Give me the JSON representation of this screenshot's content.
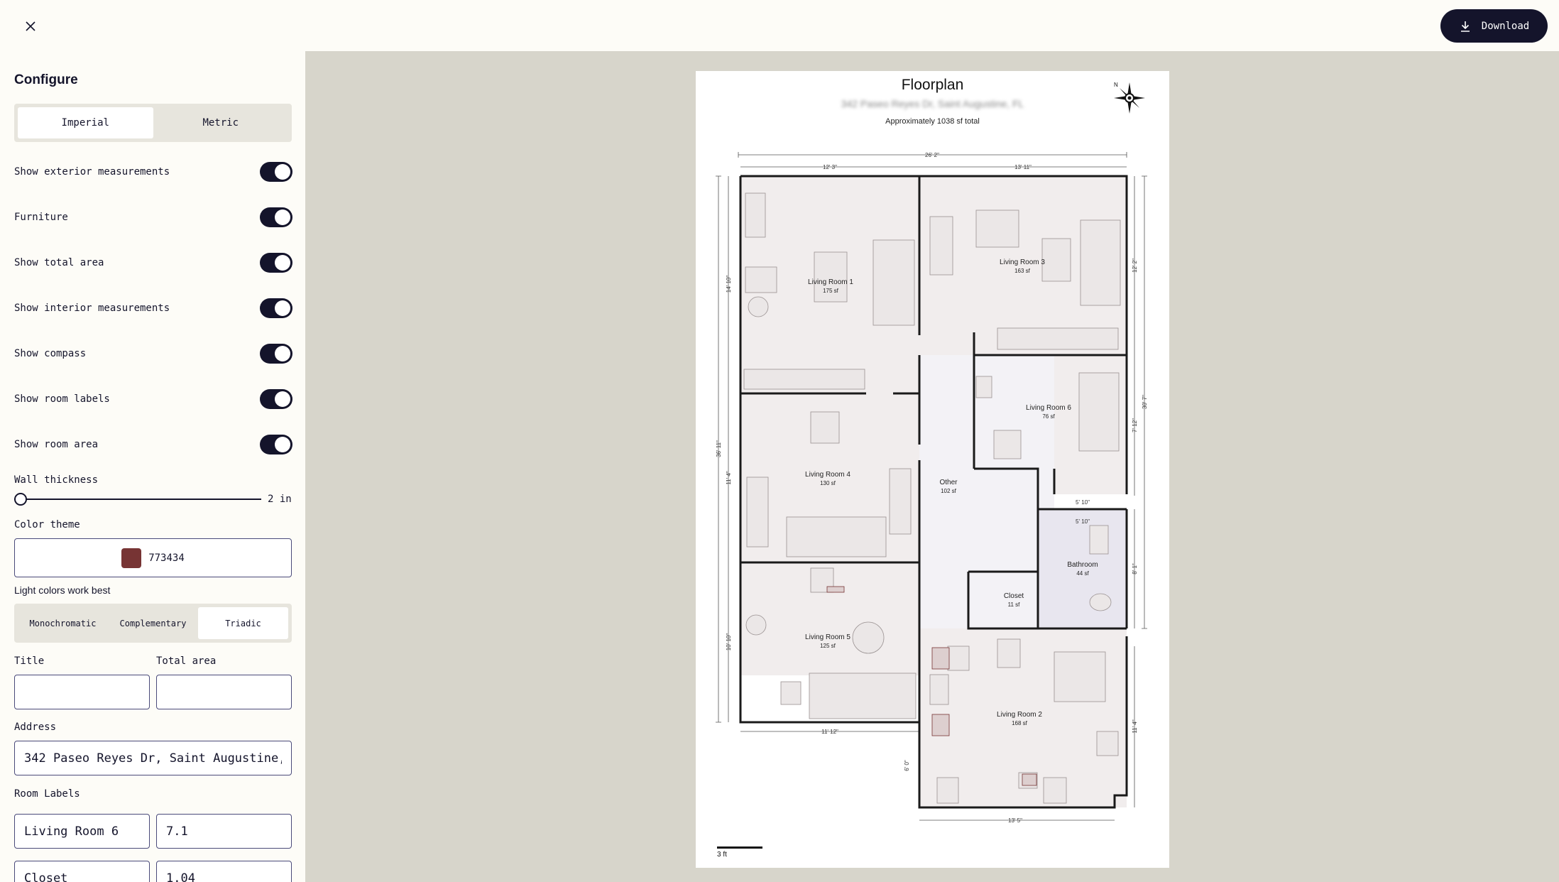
{
  "toolbar": {
    "close_icon": "close-icon",
    "download_label": "Download",
    "download_icon": "download-icon"
  },
  "sidebar": {
    "title": "Configure",
    "units": {
      "options": [
        "Imperial",
        "Metric"
      ],
      "selected": "Imperial"
    },
    "toggles": [
      {
        "label": "Show exterior measurements",
        "on": true
      },
      {
        "label": "Furniture",
        "on": true
      },
      {
        "label": "Show total area",
        "on": true
      },
      {
        "label": "Show interior measurements",
        "on": true
      },
      {
        "label": "Show compass",
        "on": true
      },
      {
        "label": "Show room labels",
        "on": true
      },
      {
        "label": "Show room area",
        "on": true
      }
    ],
    "wall_thickness": {
      "label": "Wall thickness",
      "value_text": "2 in",
      "level": 0
    },
    "color_theme": {
      "label": "Color theme",
      "hex": "773434",
      "swatch_color": "#773434",
      "hint": "Light colors work best"
    },
    "palette": {
      "options": [
        "Monochromatic",
        "Complementary",
        "Triadic"
      ],
      "selected": "Triadic"
    },
    "title_field": {
      "label": "Title",
      "value": ""
    },
    "total_area_field": {
      "label": "Total area",
      "value": ""
    },
    "address_field": {
      "label": "Address",
      "value": "342 Paseo Reyes Dr, Saint Augustine, FL"
    },
    "room_labels": {
      "label": "Room Labels",
      "rows": [
        {
          "name": "Living Room 6",
          "value": "7.1"
        },
        {
          "name": "Closet",
          "value": "1.04"
        }
      ]
    }
  },
  "floorplan": {
    "title": "Floorplan",
    "address": "342 Paseo Reyes Dr, Saint Augustine, FL",
    "total": "Approximately 1038 sf total",
    "scale_label": "3 ft",
    "compass_icon": "compass-icon",
    "accent_color": "#773434",
    "rooms": [
      {
        "name": "Living Room 1",
        "area": "175 sf"
      },
      {
        "name": "Living Room 3",
        "area": "163 sf"
      },
      {
        "name": "Living Room 6",
        "area": "76 sf"
      },
      {
        "name": "Living Room 4",
        "area": "130 sf"
      },
      {
        "name": "Other",
        "area": "102 sf"
      },
      {
        "name": "Bathroom",
        "area": "44 sf"
      },
      {
        "name": "Closet",
        "area": "11 sf"
      },
      {
        "name": "Living Room 5",
        "area": "125 sf"
      },
      {
        "name": "Living Room 2",
        "area": "168 sf"
      }
    ],
    "dims": {
      "top_total": "26' 2\"",
      "top_left": "12' 3\"",
      "top_right": "13' 11\"",
      "left_total": "36' 11\"",
      "left_a": "14' 10\"",
      "left_b": "11' 4\"",
      "left_c": "10' 10\"",
      "right_total": "30' 7\"",
      "right_a": "12' 2\"",
      "right_b": "7' 12\"",
      "right_c": "8' 1\"",
      "right_d": "11' 4\"",
      "bottom_left": "11' 12\"",
      "bottom_right": "13' 5\"",
      "mid_a": "5' 10\"",
      "mid_b": "5' 10\"",
      "low_left": "6' 0\""
    }
  }
}
